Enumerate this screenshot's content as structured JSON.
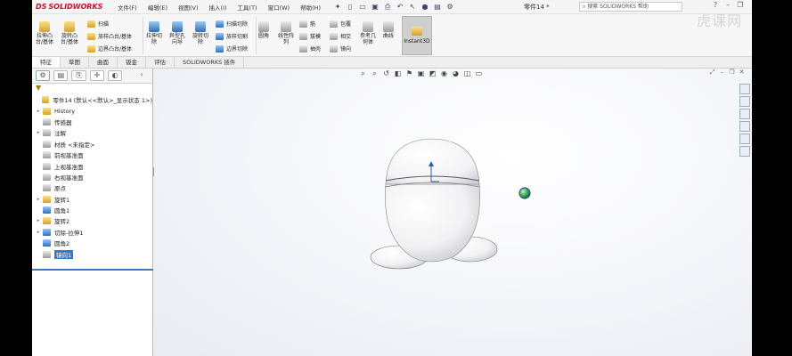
{
  "app": {
    "logo_text": "SOLIDWORKS",
    "logo_mark": "DS"
  },
  "menu": [
    "文件(F)",
    "编辑(E)",
    "视图(V)",
    "插入(I)",
    "工具(T)",
    "窗口(W)",
    "帮助(H)"
  ],
  "document_title": "零件14 *",
  "search": {
    "placeholder": "搜索 SOLIDWORKS 帮助"
  },
  "watermark": "虎课网",
  "ribbon": {
    "features": [
      {
        "label": "拉伸凸\n台/基体"
      },
      {
        "label": "旋转凸\n台/基体"
      }
    ],
    "small_a": [
      "扫描",
      "放样凸台/基体",
      "边界凸台/基体"
    ],
    "features2": [
      {
        "label": "拉伸切\n除"
      },
      {
        "label": "异型孔\n向导"
      },
      {
        "label": "旋转切\n除"
      }
    ],
    "small_b": [
      "扫描切除",
      "放样切割",
      "边界切除"
    ],
    "features3": [
      {
        "label": "圆角"
      },
      {
        "label": "线性阵\n列"
      }
    ],
    "small_c": [
      "筋",
      "拔模",
      "抽壳"
    ],
    "small_d": [
      "包覆",
      "相交",
      "镜向"
    ],
    "features4": [
      {
        "label": "参考几\n何体"
      },
      {
        "label": "曲线"
      }
    ],
    "instant3d": "Instant3D"
  },
  "command_tabs": [
    "特征",
    "草图",
    "曲面",
    "钣金",
    "评估",
    "SOLIDWORKS 插件"
  ],
  "feature_tree": {
    "root": "零件14 (默认<<默认>_显示状态 1>)",
    "items": [
      {
        "label": "History",
        "expand": true
      },
      {
        "label": "传感器",
        "expand": false
      },
      {
        "label": "注解",
        "expand": true
      },
      {
        "label": "材质 <未指定>",
        "expand": false
      },
      {
        "label": "前视基准面",
        "expand": false
      },
      {
        "label": "上视基准面",
        "expand": false
      },
      {
        "label": "右视基准面",
        "expand": false
      },
      {
        "label": "原点",
        "expand": false
      },
      {
        "label": "旋转1",
        "expand": true
      },
      {
        "label": "圆角1",
        "expand": false
      },
      {
        "label": "旋转2",
        "expand": true
      },
      {
        "label": "切除-拉伸1",
        "expand": true
      },
      {
        "label": "圆角2",
        "expand": false
      },
      {
        "label": "镜向1",
        "expand": false,
        "selected": true
      }
    ]
  },
  "colors": {
    "accent": "#3a78c8",
    "brand": "#c8102e"
  }
}
